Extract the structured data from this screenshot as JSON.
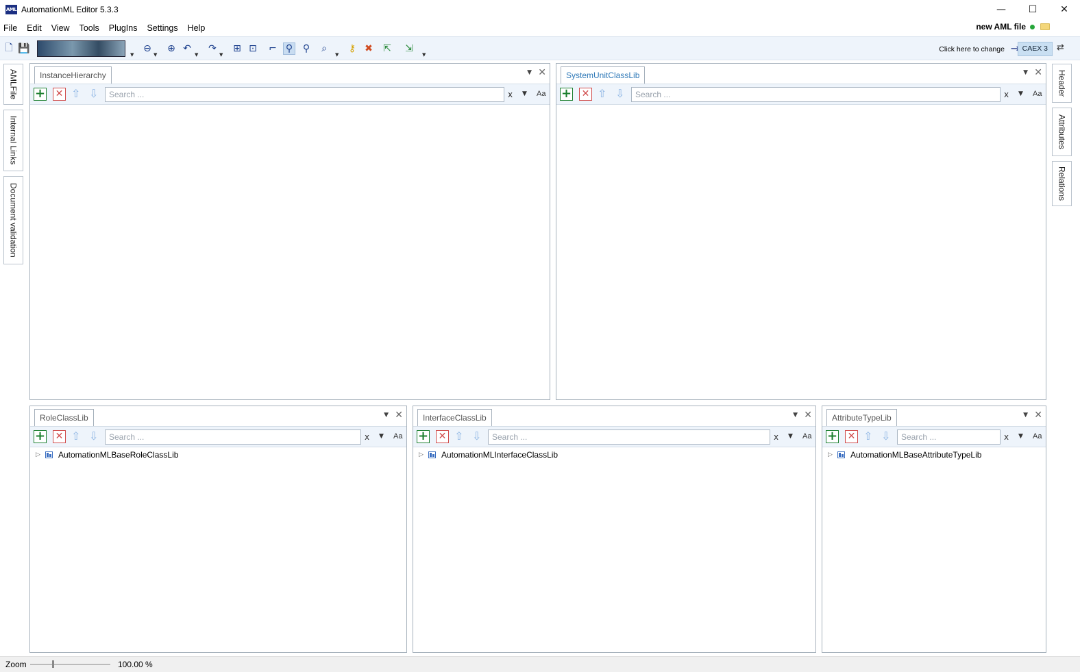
{
  "window": {
    "title": "AutomationML Editor 5.3.3",
    "app_icon_text": "AML",
    "controls": {
      "minimize": "—",
      "maximize": "☐",
      "close": "✕"
    }
  },
  "menu": {
    "items": [
      "File",
      "Edit",
      "View",
      "Tools",
      "PlugIns",
      "Settings",
      "Help"
    ],
    "file_status": "new AML file"
  },
  "toolbar": {
    "change_label": "Click here to change",
    "caex_version": "CAEX 3"
  },
  "left_tabs": [
    "AMLFile",
    "Internal Links",
    "Document validation"
  ],
  "right_tabs": [
    "Header",
    "Attributes",
    "Relations"
  ],
  "search": {
    "placeholder": "Search ...",
    "clear_label": "x",
    "case_label": "Aa"
  },
  "panels": {
    "instance_hierarchy": {
      "title": "InstanceHierarchy",
      "items": []
    },
    "system_unit_class_lib": {
      "title": "SystemUnitClassLib",
      "items": []
    },
    "role_class_lib": {
      "title": "RoleClassLib",
      "items": [
        "AutomationMLBaseRoleClassLib"
      ]
    },
    "interface_class_lib": {
      "title": "InterfaceClassLib",
      "items": [
        "AutomationMLInterfaceClassLib"
      ]
    },
    "attribute_type_lib": {
      "title": "AttributeTypeLib",
      "items": [
        "AutomationMLBaseAttributeTypeLib"
      ]
    }
  },
  "statusbar": {
    "zoom_label": "Zoom",
    "zoom_value": "100.00 %",
    "zoom_level": 0.27
  },
  "colors": {
    "toolbar_bg": "#eef4fb",
    "active_tab": "#2f79b8",
    "add_green": "#1b7f2e",
    "delete_red": "#d04b4b",
    "brand_blue": "#1b2f82"
  }
}
